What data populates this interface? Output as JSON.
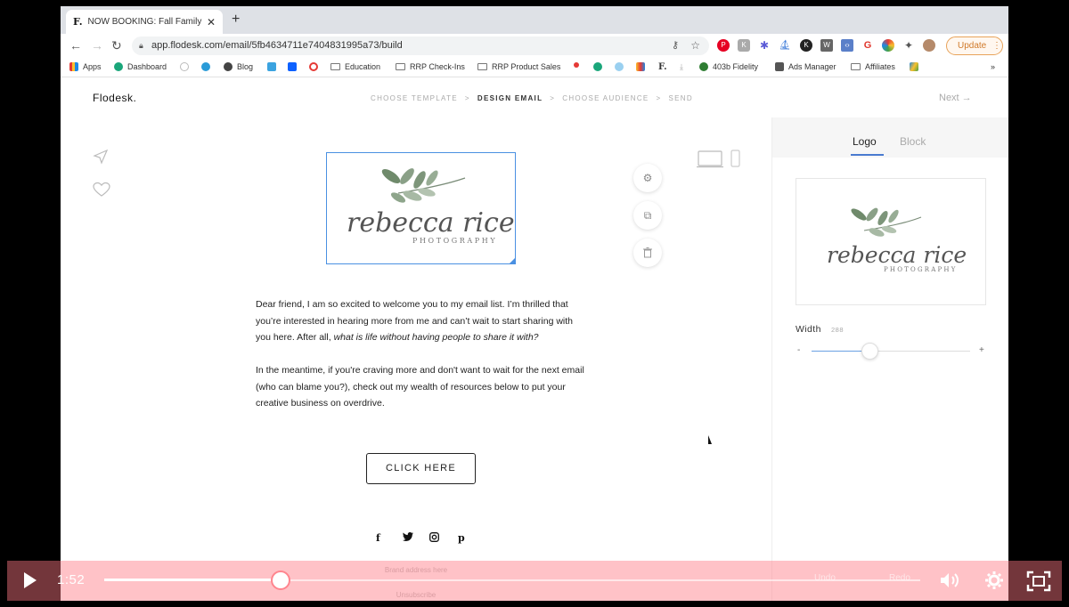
{
  "browser": {
    "tab_title": "NOW BOOKING: Fall Family Mi",
    "tab_favicon": "F.",
    "url": "app.flodesk.com/email/5fb4634711e7404831995a73/build",
    "update_label": "Update"
  },
  "bookmarks": [
    {
      "label": "Apps",
      "icon": "apps-grid-icon"
    },
    {
      "label": "Dashboard",
      "icon": "dashboard-icon"
    },
    {
      "label": "",
      "icon": "peace-icon"
    },
    {
      "label": "",
      "icon": "app-icon"
    },
    {
      "label": "Blog",
      "icon": "globe-icon"
    },
    {
      "label": "",
      "icon": "square-icon"
    },
    {
      "label": "",
      "icon": "dropbox-icon"
    },
    {
      "label": "",
      "icon": "circle-icon"
    },
    {
      "label": "Education",
      "icon": "folder-icon"
    },
    {
      "label": "RRP Check-Ins",
      "icon": "folder-icon"
    },
    {
      "label": "RRP Product Sales",
      "icon": "folder-icon"
    },
    {
      "label": "403b Fidelity",
      "icon": "fidelity-icon"
    },
    {
      "label": "Ads Manager",
      "icon": "ads-icon"
    },
    {
      "label": "Affiliates",
      "icon": "folder-icon"
    }
  ],
  "flodesk": {
    "logo": "Flodesk.",
    "steps": [
      "CHOOSE TEMPLATE",
      ">",
      "DESIGN EMAIL",
      ">",
      "CHOOSE AUDIENCE",
      ">",
      "SEND"
    ],
    "next_label": "Next →"
  },
  "email": {
    "logo_script": "rebecca rice",
    "logo_sub": "PHOTOGRAPHY",
    "para1_line1": "Dear friend, I am so excited to welcome you to my email list. I’m thrilled that",
    "para1_line2": "you’re interested in hearing more from me and can’t wait to start sharing with",
    "para1_line3": "you here. After all, ",
    "para1_italic": "what is life without having people to share it with?",
    "para2_line1": "In the meantime, if you're craving more and don't want to wait for the next email",
    "para2_line2": "(who can blame you?), check out my wealth of resources below to put your",
    "para2_line3": "creative business on overdrive.",
    "cta_label": "CLICK HERE",
    "social": [
      "f",
      "t",
      "i",
      "p"
    ],
    "footer_address": "Brand address here",
    "footer_unsubscribe": "Unsubscribe"
  },
  "panel": {
    "tabs": [
      "Logo",
      "Block"
    ],
    "width_label": "Width",
    "width_value": "288",
    "slider_min": "-",
    "slider_max": "+",
    "slider_fraction": 0.37
  },
  "video": {
    "time": "1:52",
    "progress_fraction": 0.216,
    "undo_label": "Undo",
    "redo_label": "Redo"
  }
}
